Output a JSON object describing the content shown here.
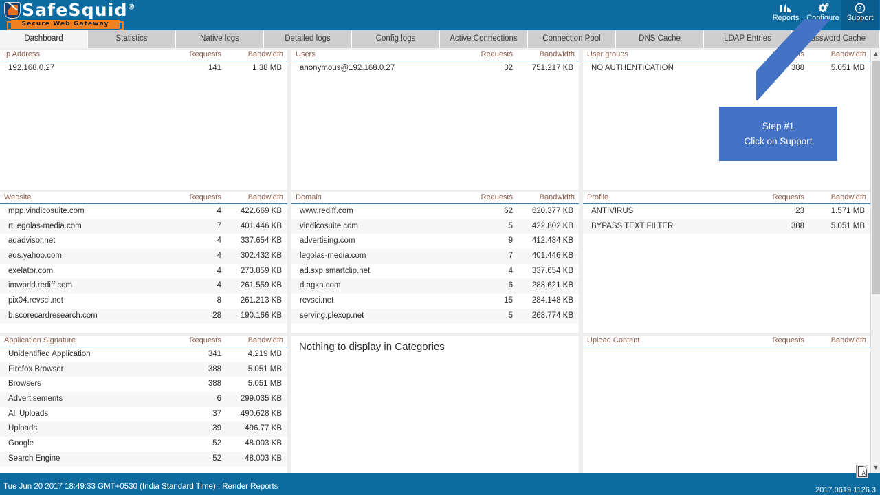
{
  "header": {
    "brand": "SafeSquid",
    "brand_reg": "®",
    "tagline": "Secure Web Gateway",
    "nav": [
      {
        "label": "Reports",
        "icon": "chart-icon",
        "active": false
      },
      {
        "label": "Configure",
        "icon": "gears-icon",
        "active": false
      },
      {
        "label": "Support",
        "icon": "help-icon",
        "active": true
      }
    ]
  },
  "tabs": [
    {
      "label": "Dashboard",
      "active": true
    },
    {
      "label": "Statistics",
      "active": false
    },
    {
      "label": "Native logs",
      "active": false
    },
    {
      "label": "Detailed logs",
      "active": false
    },
    {
      "label": "Config logs",
      "active": false
    },
    {
      "label": "Active Connections",
      "active": false
    },
    {
      "label": "Connection Pool",
      "active": false
    },
    {
      "label": "DNS Cache",
      "active": false
    },
    {
      "label": "LDAP Entries",
      "active": false
    },
    {
      "label": "Password Cache",
      "active": false
    }
  ],
  "columns": {
    "requests": "Requests",
    "bandwidth": "Bandwidth"
  },
  "panels": [
    {
      "id": "ip-address",
      "title": "Ip Address",
      "rows": [
        {
          "name": "192.168.0.27",
          "requests": "141",
          "bandwidth": "1.38 MB"
        }
      ]
    },
    {
      "id": "users",
      "title": "Users",
      "rows": [
        {
          "name": "anonymous@192.168.0.27",
          "requests": "32",
          "bandwidth": "751.217 KB"
        }
      ]
    },
    {
      "id": "user-groups",
      "title": "User groups",
      "rows": [
        {
          "name": "NO AUTHENTICATION",
          "requests": "388",
          "bandwidth": "5.051 MB"
        }
      ]
    },
    {
      "id": "website",
      "title": "Website",
      "rows": [
        {
          "name": "mpp.vindicosuite.com",
          "requests": "4",
          "bandwidth": "422.669 KB"
        },
        {
          "name": "rt.legolas-media.com",
          "requests": "7",
          "bandwidth": "401.446 KB"
        },
        {
          "name": "adadvisor.net",
          "requests": "4",
          "bandwidth": "337.654 KB"
        },
        {
          "name": "ads.yahoo.com",
          "requests": "4",
          "bandwidth": "302.432 KB"
        },
        {
          "name": "exelator.com",
          "requests": "4",
          "bandwidth": "273.859 KB"
        },
        {
          "name": "imworld.rediff.com",
          "requests": "4",
          "bandwidth": "261.559 KB"
        },
        {
          "name": "pix04.revsci.net",
          "requests": "8",
          "bandwidth": "261.213 KB"
        },
        {
          "name": "b.scorecardresearch.com",
          "requests": "28",
          "bandwidth": "190.166 KB"
        }
      ]
    },
    {
      "id": "domain",
      "title": "Domain",
      "rows": [
        {
          "name": "www.rediff.com",
          "requests": "62",
          "bandwidth": "620.377 KB"
        },
        {
          "name": "vindicosuite.com",
          "requests": "5",
          "bandwidth": "422.802 KB"
        },
        {
          "name": "advertising.com",
          "requests": "9",
          "bandwidth": "412.484 KB"
        },
        {
          "name": "legolas-media.com",
          "requests": "7",
          "bandwidth": "401.446 KB"
        },
        {
          "name": "ad.sxp.smartclip.net",
          "requests": "4",
          "bandwidth": "337.654 KB"
        },
        {
          "name": "d.agkn.com",
          "requests": "6",
          "bandwidth": "288.621 KB"
        },
        {
          "name": "revsci.net",
          "requests": "15",
          "bandwidth": "284.148 KB"
        },
        {
          "name": "serving.plexop.net",
          "requests": "5",
          "bandwidth": "268.774 KB"
        }
      ]
    },
    {
      "id": "profile",
      "title": "Profile",
      "rows": [
        {
          "name": "ANTIVIRUS",
          "requests": "23",
          "bandwidth": "1.571 MB"
        },
        {
          "name": "BYPASS TEXT FILTER",
          "requests": "388",
          "bandwidth": "5.051 MB"
        }
      ]
    },
    {
      "id": "application-signature",
      "title": "Application Signature",
      "rows": [
        {
          "name": "Unidentified Application",
          "requests": "341",
          "bandwidth": "4.219 MB"
        },
        {
          "name": "Firefox Browser",
          "requests": "388",
          "bandwidth": "5.051 MB"
        },
        {
          "name": "Browsers",
          "requests": "388",
          "bandwidth": "5.051 MB"
        },
        {
          "name": "Advertisements",
          "requests": "6",
          "bandwidth": "299.035 KB"
        },
        {
          "name": "All Uploads",
          "requests": "37",
          "bandwidth": "490.628 KB"
        },
        {
          "name": "Uploads",
          "requests": "39",
          "bandwidth": "496.77 KB"
        },
        {
          "name": "Google",
          "requests": "52",
          "bandwidth": "48.003 KB"
        },
        {
          "name": "Search Engine",
          "requests": "52",
          "bandwidth": "48.003 KB"
        }
      ]
    },
    {
      "id": "categories",
      "empty_message": "Nothing to display in Categories",
      "rows": []
    },
    {
      "id": "upload-content",
      "title": "Upload Content",
      "rows": []
    }
  ],
  "annotation": {
    "line1": "Step #1",
    "line2": "Click on Support",
    "color": "#4472c4"
  },
  "footer": {
    "status": "Tue Jun 20 2017 18:49:33 GMT+0530 (India Standard Time) : Render Reports",
    "version": "2017.0619.1126.3",
    "export_icon": "pdf-icon"
  },
  "theme": {
    "brand_blue": "#0d6ba0",
    "accent_orange": "#f07f20",
    "header_rule": "#3f7fb5"
  }
}
